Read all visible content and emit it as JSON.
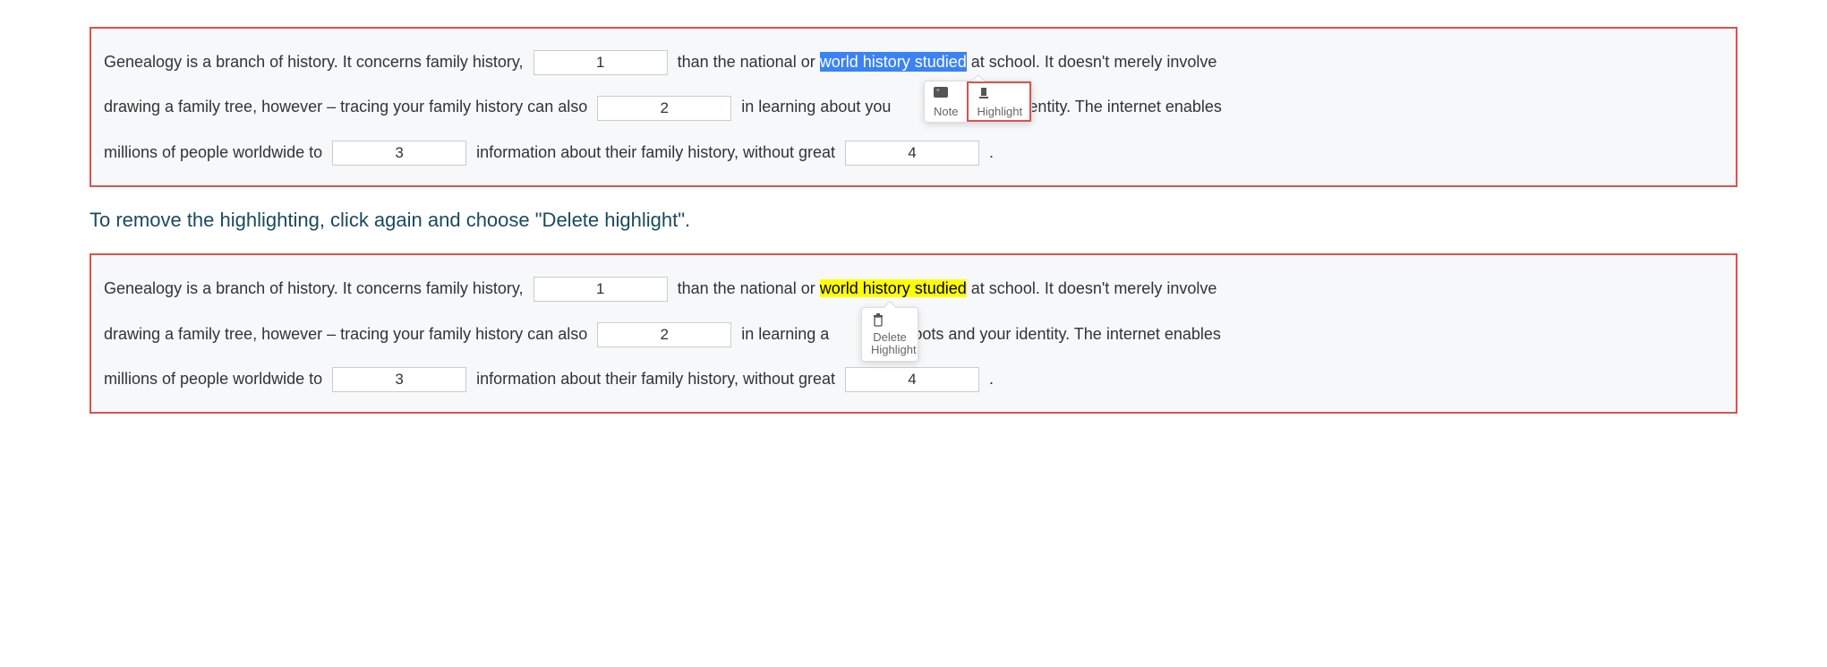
{
  "text": {
    "seg1": "Genealogy is a branch of history. It concerns family history,",
    "seg2": " than the national or ",
    "seg3": "world history studied",
    "seg4": " at school. It doesn't merely involve",
    "seg5": "drawing a family tree, however – tracing your family history can also ",
    "seg6": " in learning about you",
    "seg6b": " in learning a",
    "seg6c": "roots and your identity. The internet enables",
    "seg7": " identity. The internet enables",
    "seg8": "millions of people worldwide to ",
    "seg9": " information about their family history, without great ",
    "period": "."
  },
  "blanks": {
    "b1": "1",
    "b2": "2",
    "b3": "3",
    "b4": "4"
  },
  "instruction": "To remove the highlighting, click again and choose \"Delete highlight\".",
  "popup1": {
    "note": "Note",
    "highlight": "Highlight"
  },
  "popup2": {
    "delete": "Delete Highlight"
  }
}
